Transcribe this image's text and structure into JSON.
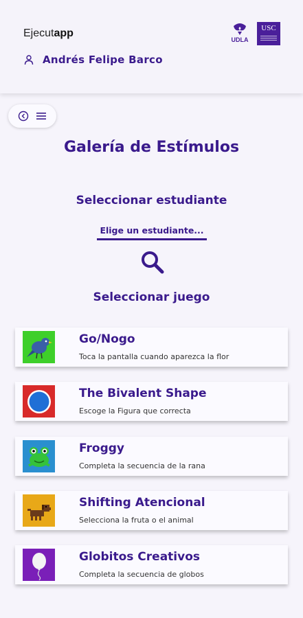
{
  "header": {
    "brand_prefix": "Ejecut",
    "brand_suffix": "app",
    "user_name": "Andrés Felipe Barco",
    "logo_udla": "UDLA",
    "logo_usc": "USC"
  },
  "page": {
    "title": "Galería de Estímulos",
    "select_student_heading": "Seleccionar estudiante",
    "student_select_value": "Elige un estudiante...",
    "select_game_heading": "Seleccionar juego"
  },
  "games": [
    {
      "title": "Go/Nogo",
      "description": "Toca la pantalla cuando aparezca la flor",
      "icon": "bird-icon"
    },
    {
      "title": "The Bivalent Shape",
      "description": "Escoge la Figura que correcta",
      "icon": "circle-shape-icon"
    },
    {
      "title": "Froggy",
      "description": "Completa la secuencia de la rana",
      "icon": "frog-icon"
    },
    {
      "title": "Shifting Atencional",
      "description": "Selecciona la fruta o el animal",
      "icon": "dog-icon"
    },
    {
      "title": "Globitos Creativos",
      "description": "Completa la secuencia de globos",
      "icon": "balloon-icon"
    }
  ],
  "colors": {
    "accent": "#3a1a8c",
    "background": "#f6f4fb",
    "card": "#fbfaff"
  }
}
